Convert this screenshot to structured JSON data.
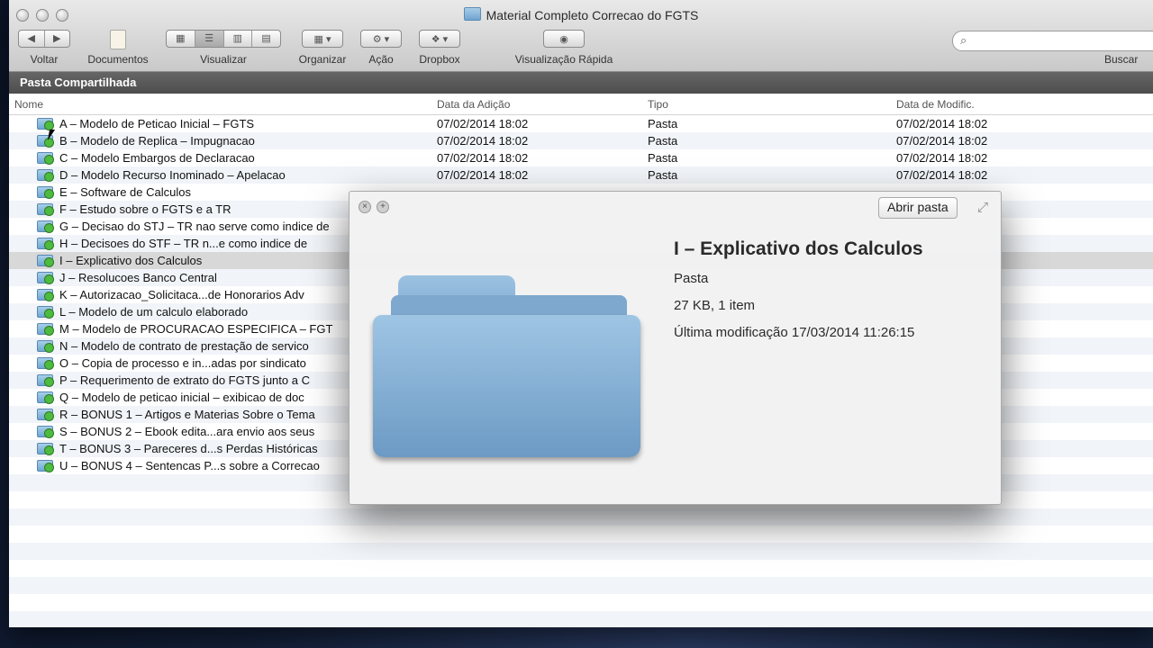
{
  "window": {
    "title": "Material Completo Correcao do FGTS"
  },
  "toolbar": {
    "back": "Voltar",
    "documents": "Documentos",
    "view": "Visualizar",
    "arrange": "Organizar",
    "action": "Ação",
    "dropbox": "Dropbox",
    "quicklook": "Visualização Rápida",
    "search": "Buscar",
    "search_placeholder": ""
  },
  "pathbar": {
    "label": "Pasta Compartilhada"
  },
  "columns": {
    "name": "Nome",
    "date_added": "Data da Adição",
    "kind": "Tipo",
    "date_modified": "Data de Modific."
  },
  "files": [
    {
      "name": "A – Modelo de Peticao Inicial – FGTS",
      "added": "07/02/2014 18:02",
      "kind": "Pasta",
      "modified": "07/02/2014 18:02"
    },
    {
      "name": "B – Modelo de Replica – Impugnacao",
      "added": "07/02/2014 18:02",
      "kind": "Pasta",
      "modified": "07/02/2014 18:02"
    },
    {
      "name": "C – Modelo Embargos de Declaracao",
      "added": "07/02/2014 18:02",
      "kind": "Pasta",
      "modified": "07/02/2014 18:02"
    },
    {
      "name": "D – Modelo Recurso Inominado – Apelacao",
      "added": "07/02/2014 18:02",
      "kind": "Pasta",
      "modified": "07/02/2014 18:02"
    },
    {
      "name": "E – Software de Calculos",
      "added": "",
      "kind": "",
      "modified": ""
    },
    {
      "name": "F – Estudo sobre o FGTS e a TR",
      "added": "",
      "kind": "",
      "modified": ""
    },
    {
      "name": "G – Decisao do STJ – TR nao serve como indice de",
      "added": "",
      "kind": "",
      "modified": ""
    },
    {
      "name": "H – Decisoes do STF – TR n...e como indice de",
      "added": "",
      "kind": "",
      "modified": ""
    },
    {
      "name": "I – Explicativo dos Calculos",
      "added": "",
      "kind": "",
      "modified": "",
      "selected": true
    },
    {
      "name": "J – Resolucoes Banco Central",
      "added": "",
      "kind": "",
      "modified": ""
    },
    {
      "name": "K – Autorizacao_Solicitaca...de Honorarios Adv",
      "added": "",
      "kind": "",
      "modified": ""
    },
    {
      "name": "L – Modelo de um calculo elaborado",
      "added": "",
      "kind": "",
      "modified": ""
    },
    {
      "name": "M – Modelo de PROCURACAO ESPECIFICA – FGT",
      "added": "",
      "kind": "",
      "modified": ""
    },
    {
      "name": "N – Modelo de contrato de prestação de servico",
      "added": "",
      "kind": "",
      "modified": ""
    },
    {
      "name": "O – Copia de processo e in...adas por sindicato",
      "added": "",
      "kind": "",
      "modified": ""
    },
    {
      "name": "P – Requerimento de extrato do FGTS junto a C",
      "added": "",
      "kind": "",
      "modified": ""
    },
    {
      "name": "Q – Modelo de peticao inicial – exibicao de doc",
      "added": "",
      "kind": "",
      "modified": ""
    },
    {
      "name": "R – BONUS 1 – Artigos e Materias Sobre o Tema",
      "added": "",
      "kind": "",
      "modified": ""
    },
    {
      "name": "S – BONUS 2 – Ebook edita...ara envio aos seus",
      "added": "",
      "kind": "",
      "modified": ""
    },
    {
      "name": "T – BONUS 3 – Pareceres d...s Perdas Históricas",
      "added": "",
      "kind": "",
      "modified": ""
    },
    {
      "name": "U – BONUS 4 – Sentencas P...s sobre a Correcao",
      "added": "",
      "kind": "",
      "modified": ""
    }
  ],
  "quicklook": {
    "open_button": "Abrir pasta",
    "title": "I – Explicativo dos Calculos",
    "kind": "Pasta",
    "size": "27 KB, 1 item",
    "modified": "Última modificação 17/03/2014 11:26:15"
  }
}
